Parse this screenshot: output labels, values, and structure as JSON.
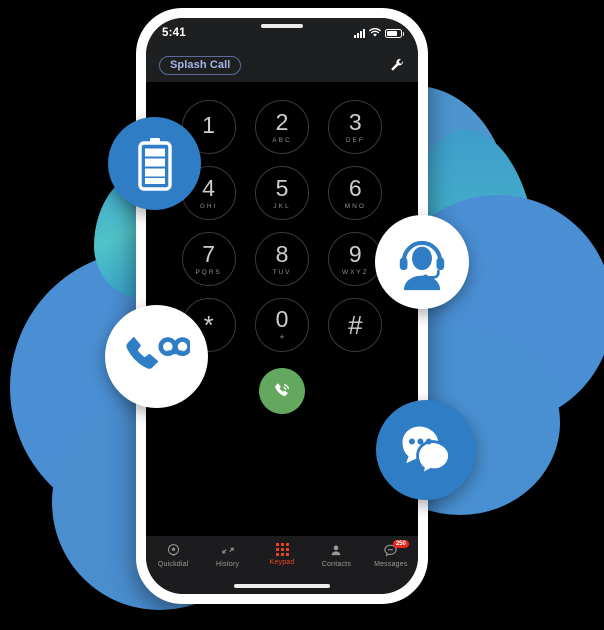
{
  "phone": {
    "status_bar": {
      "time": "5:41",
      "signal_icon": "cellular-signal-icon",
      "wifi_icon": "wifi-icon",
      "battery_icon": "battery-icon"
    },
    "app_bar": {
      "brand_label": "Splash Call",
      "settings_icon": "wrench-icon"
    },
    "keypad": {
      "keys": [
        {
          "num": "1",
          "sub": ""
        },
        {
          "num": "2",
          "sub": "ABC"
        },
        {
          "num": "3",
          "sub": "DEF"
        },
        {
          "num": "4",
          "sub": "GHI"
        },
        {
          "num": "5",
          "sub": "JKL"
        },
        {
          "num": "6",
          "sub": "MNO"
        },
        {
          "num": "7",
          "sub": "PQRS"
        },
        {
          "num": "8",
          "sub": "TUV"
        },
        {
          "num": "9",
          "sub": "WXYZ"
        },
        {
          "num": "*",
          "sub": ""
        },
        {
          "num": "0",
          "sub": "+"
        },
        {
          "num": "#",
          "sub": ""
        }
      ]
    },
    "call_button": {
      "icon": "phone-call-icon",
      "color": "#63a85f"
    },
    "tab_bar": {
      "active_color": "#e8451f",
      "inactive_color": "#9a9a9a",
      "tabs": [
        {
          "label": "Quickdial",
          "icon": "star-circle-icon",
          "active": false,
          "badge": ""
        },
        {
          "label": "History",
          "icon": "call-history-arrows-icon",
          "active": false,
          "badge": ""
        },
        {
          "label": "Keypad",
          "icon": "keypad-dots-icon",
          "active": true,
          "badge": ""
        },
        {
          "label": "Contacts",
          "icon": "person-icon",
          "active": false,
          "badge": ""
        },
        {
          "label": "Messages",
          "icon": "message-bubble-icon",
          "active": false,
          "badge": "250"
        }
      ]
    }
  },
  "feature_icons": [
    {
      "name": "battery-icon",
      "style": "blue-circle-white-glyph",
      "circle_color": "#2f7dc4",
      "glyph_color": "#ffffff"
    },
    {
      "name": "headset-support-icon",
      "style": "white-circle-blue-glyph",
      "circle_color": "#ffffff",
      "glyph_color": "#2f7dc4"
    },
    {
      "name": "voicemail-icon",
      "style": "white-circle-blue-glyph",
      "circle_color": "#ffffff",
      "glyph_color": "#2f7dc4"
    },
    {
      "name": "chat-bubbles-icon",
      "style": "blue-circle-white-glyph",
      "circle_color": "#2f7dc4",
      "glyph_color": "#ffffff"
    }
  ],
  "background": {
    "canvas_color": "#000000",
    "blob_blue": "#4a8fd4",
    "blob_teal": "#49c2c7",
    "phone_frame_color": "#ffffff",
    "screen_color": "#000000"
  }
}
